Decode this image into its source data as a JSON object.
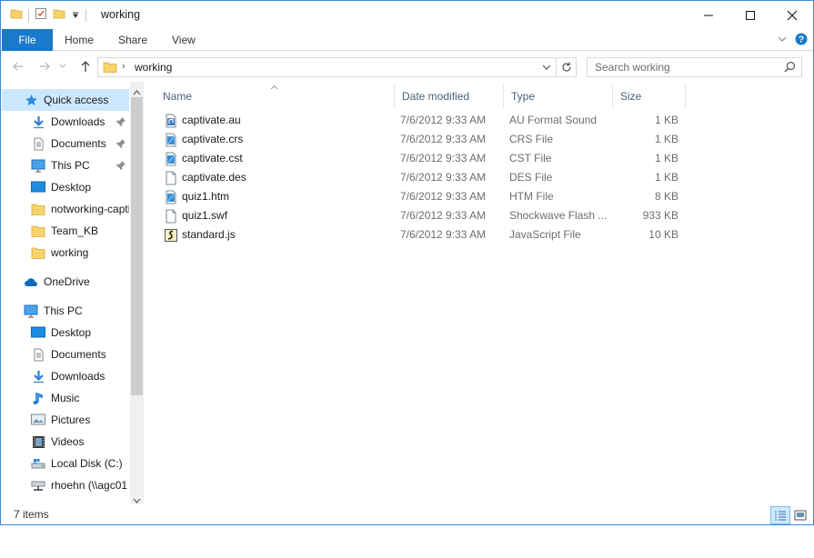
{
  "window": {
    "title": "working",
    "accent_color": "#1979ca"
  },
  "ribbon": {
    "tabs": [
      {
        "label": "File"
      },
      {
        "label": "Home"
      },
      {
        "label": "Share"
      },
      {
        "label": "View"
      }
    ]
  },
  "address": {
    "path": [
      "working"
    ]
  },
  "search": {
    "placeholder": "Search working"
  },
  "nav": {
    "items": [
      {
        "label": "Quick access",
        "icon": "star-icon"
      },
      {
        "label": "Downloads",
        "icon": "download-icon"
      },
      {
        "label": "Documents",
        "icon": "document-icon"
      },
      {
        "label": "This PC",
        "icon": "computer-icon"
      },
      {
        "label": "Desktop",
        "icon": "desktop-icon"
      },
      {
        "label": "notworking-captivate",
        "icon": "folder-icon"
      },
      {
        "label": "Team_KB",
        "icon": "folder-icon"
      },
      {
        "label": "working",
        "icon": "folder-icon"
      },
      {
        "label": "OneDrive",
        "icon": "cloud-icon"
      },
      {
        "label": "This PC",
        "icon": "computer-icon"
      },
      {
        "label": "Desktop",
        "icon": "desktop-icon"
      },
      {
        "label": "Documents",
        "icon": "document-icon"
      },
      {
        "label": "Downloads",
        "icon": "download-icon"
      },
      {
        "label": "Music",
        "icon": "music-icon"
      },
      {
        "label": "Pictures",
        "icon": "picture-icon"
      },
      {
        "label": "Videos",
        "icon": "video-icon"
      },
      {
        "label": "Local Disk (C:)",
        "icon": "drive-icon"
      },
      {
        "label": "rhoehn (\\\\agc01",
        "icon": "network-drive-icon"
      }
    ]
  },
  "columns": [
    {
      "label": "Name"
    },
    {
      "label": "Date modified"
    },
    {
      "label": "Type"
    },
    {
      "label": "Size"
    }
  ],
  "files": [
    {
      "name": "captivate.au",
      "date": "7/6/2012 9:33 AM",
      "type": "AU Format Sound",
      "size": "1 KB",
      "icon": "audio-file-icon"
    },
    {
      "name": "captivate.crs",
      "date": "7/6/2012 9:33 AM",
      "type": "CRS File",
      "size": "1 KB",
      "icon": "blue-file-icon"
    },
    {
      "name": "captivate.cst",
      "date": "7/6/2012 9:33 AM",
      "type": "CST File",
      "size": "1 KB",
      "icon": "blue-file-icon"
    },
    {
      "name": "captivate.des",
      "date": "7/6/2012 9:33 AM",
      "type": "DES File",
      "size": "1 KB",
      "icon": "blank-file-icon"
    },
    {
      "name": "quiz1.htm",
      "date": "7/6/2012 9:33 AM",
      "type": "HTM File",
      "size": "8 KB",
      "icon": "blue-file-icon"
    },
    {
      "name": "quiz1.swf",
      "date": "7/6/2012 9:33 AM",
      "type": "Shockwave Flash ...",
      "size": "933 KB",
      "icon": "blank-file-icon"
    },
    {
      "name": "standard.js",
      "date": "7/6/2012 9:33 AM",
      "type": "JavaScript File",
      "size": "10 KB",
      "icon": "script-file-icon"
    }
  ],
  "status": {
    "item_count": "7 items"
  }
}
